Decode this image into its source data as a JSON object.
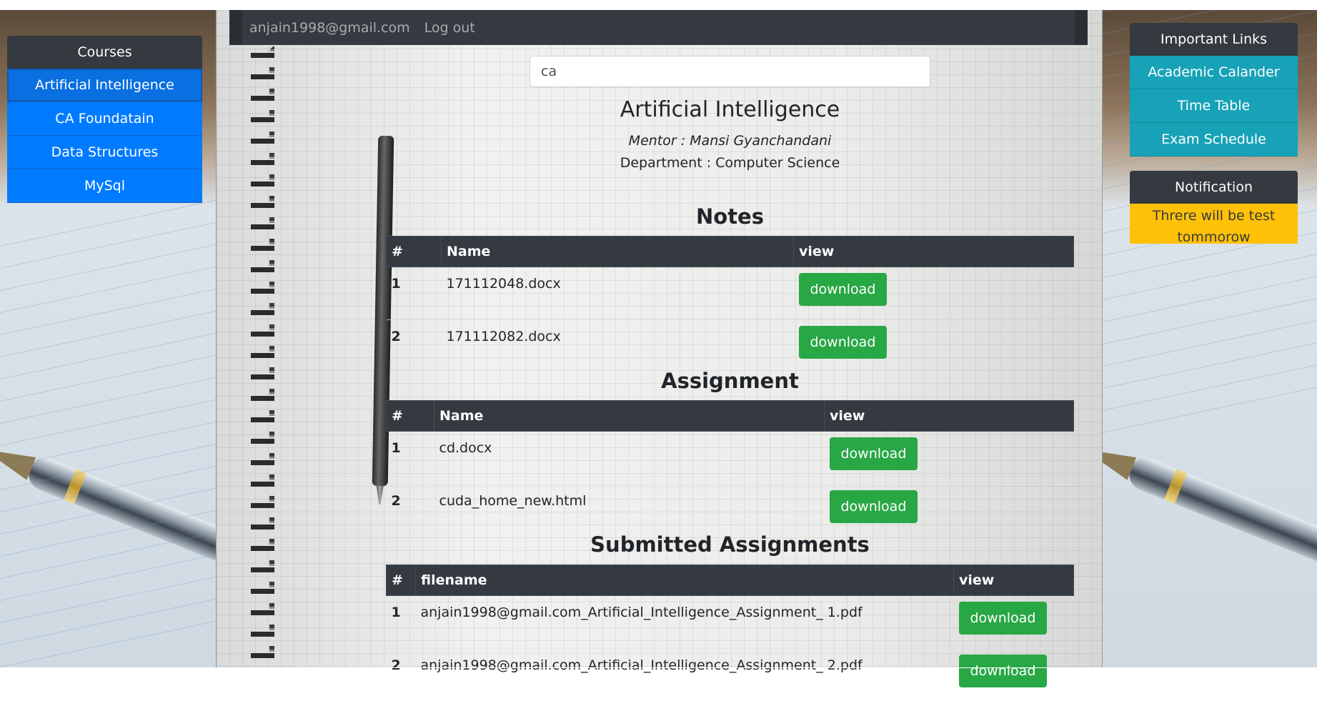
{
  "navbar": {
    "email": "anjain1998@gmail.com",
    "logout_label": "Log out"
  },
  "courses": {
    "header": "Courses",
    "items": [
      {
        "label": "Artificial Intelligence",
        "active": true
      },
      {
        "label": "CA Foundatain",
        "active": false
      },
      {
        "label": "Data Structures",
        "active": false
      },
      {
        "label": "MySql",
        "active": false
      }
    ]
  },
  "important_links": {
    "header": "Important Links",
    "items": [
      {
        "label": "Academic Calander"
      },
      {
        "label": "Time Table"
      },
      {
        "label": "Exam Schedule"
      }
    ]
  },
  "notification": {
    "header": "Notification",
    "text": "Threre will be test tommorow"
  },
  "search": {
    "value": "ca"
  },
  "course": {
    "title": "Artificial Intelligence",
    "mentor": "Mentor : Mansi Gyanchandani",
    "department": "Department : Computer Science"
  },
  "notes": {
    "title": "Notes",
    "columns": [
      "#",
      "Name",
      "view"
    ],
    "rows": [
      {
        "num": "1",
        "name": "171112048.docx",
        "action": "download"
      },
      {
        "num": "2",
        "name": "171112082.docx",
        "action": "download"
      }
    ]
  },
  "assignment": {
    "title": "Assignment",
    "columns": [
      "#",
      "Name",
      "view"
    ],
    "rows": [
      {
        "num": "1",
        "name": "cd.docx",
        "action": "download"
      },
      {
        "num": "2",
        "name": "cuda_home_new.html",
        "action": "download"
      }
    ]
  },
  "submitted": {
    "title": "Submitted Assignments",
    "columns": [
      "#",
      "filename",
      "view"
    ],
    "rows": [
      {
        "num": "1",
        "name": "anjain1998@gmail.com_Artificial_Intelligence_Assignment_ 1.pdf",
        "action": "download"
      },
      {
        "num": "2",
        "name": "anjain1998@gmail.com_Artificial_Intelligence_Assignment_ 2.pdf",
        "action": "download"
      }
    ]
  },
  "colors": {
    "navbar": "#343a40",
    "course_item": "#007bff",
    "link_item": "#17a2b8",
    "notification": "#ffc107",
    "download_button": "#28a745"
  }
}
